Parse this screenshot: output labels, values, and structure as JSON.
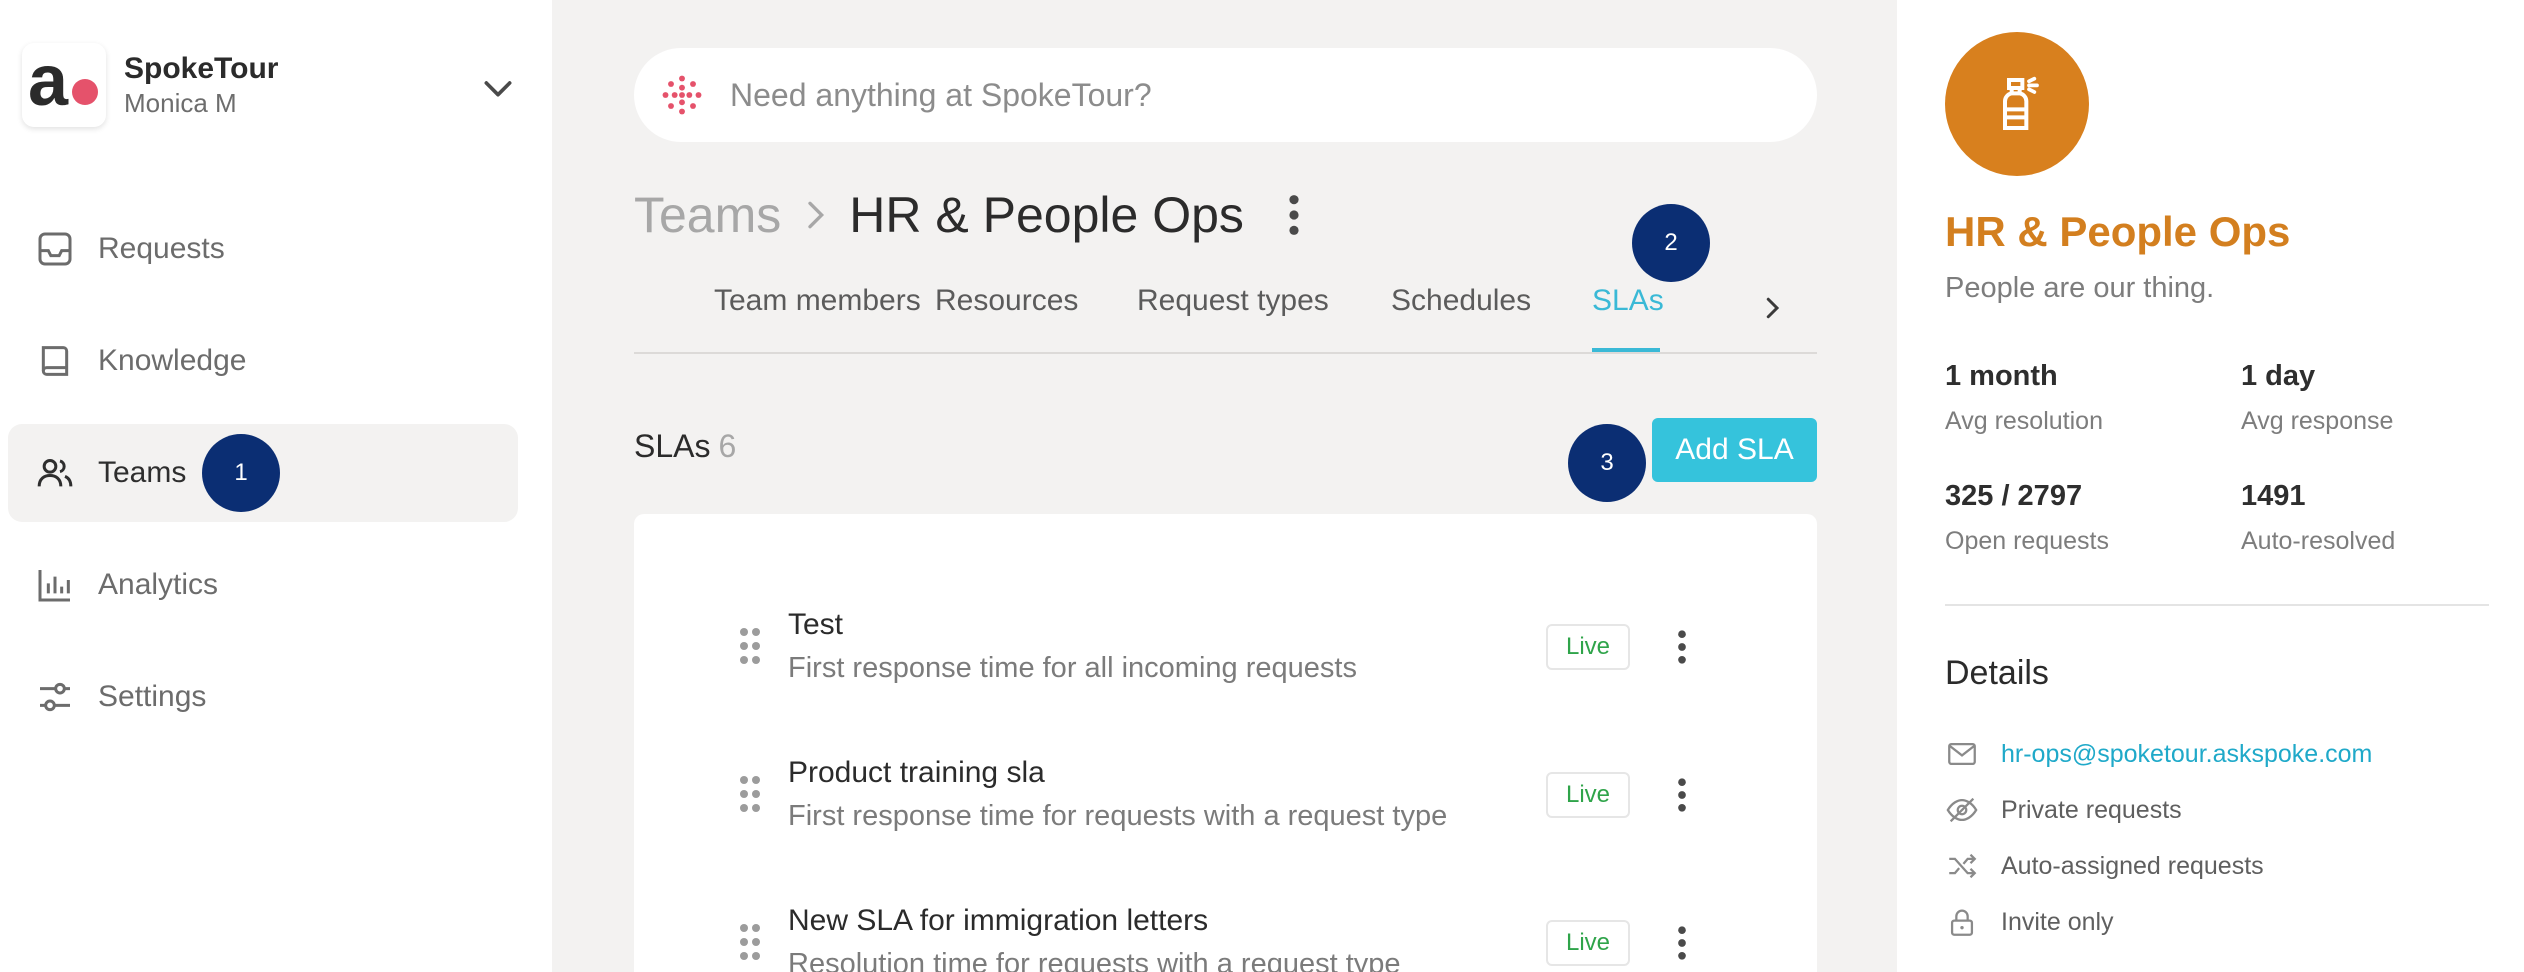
{
  "org": {
    "name": "SpokeTour",
    "user": "Monica M",
    "logo_letter": "a"
  },
  "sidebar": {
    "items": [
      {
        "label": "Requests",
        "icon": "inbox-icon"
      },
      {
        "label": "Knowledge",
        "icon": "book-icon"
      },
      {
        "label": "Teams",
        "icon": "people-icon",
        "active": true
      },
      {
        "label": "Analytics",
        "icon": "bar-chart-icon"
      },
      {
        "label": "Settings",
        "icon": "sliders-icon"
      }
    ]
  },
  "badges": {
    "b1": "1",
    "b2": "2",
    "b3": "3"
  },
  "search": {
    "placeholder": "Need anything at SpokeTour?"
  },
  "breadcrumb": {
    "root": "Teams",
    "current": "HR & People Ops"
  },
  "tabs": [
    {
      "label": "Team members"
    },
    {
      "label": "Resources"
    },
    {
      "label": "Request types"
    },
    {
      "label": "Schedules"
    },
    {
      "label": "SLAs",
      "active": true
    }
  ],
  "slas": {
    "title": "SLAs",
    "count": "6",
    "add_label": "Add SLA",
    "rows": [
      {
        "title": "Test",
        "subtitle": "First response time for all incoming requests",
        "status": "Live"
      },
      {
        "title": "Product training sla",
        "subtitle": "First response time for requests with a request type",
        "status": "Live"
      },
      {
        "title": "New SLA for immigration letters",
        "subtitle": "Resolution time for requests with a request type",
        "status": "Live"
      }
    ]
  },
  "team": {
    "name": "HR & People Ops",
    "description": "People are our thing.",
    "stats": [
      {
        "value": "1 month",
        "label": "Avg resolution"
      },
      {
        "value": "1 day",
        "label": "Avg response"
      },
      {
        "value": "325 / 2797",
        "label": "Open requests"
      },
      {
        "value": "1491",
        "label": "Auto-resolved"
      }
    ],
    "details_title": "Details",
    "details": [
      {
        "icon": "mail-icon",
        "text": "hr-ops@spoketour.askspoke.com"
      },
      {
        "icon": "eye-off-icon",
        "text": "Private requests"
      },
      {
        "icon": "shuffle-icon",
        "text": "Auto-assigned requests"
      },
      {
        "icon": "lock-icon",
        "text": "Invite only"
      }
    ]
  },
  "colors": {
    "accent": "#35c3dc",
    "team": "#d8801e",
    "badge": "#0b2e73",
    "live": "#2fa44a",
    "brand_dot": "#e5526b"
  }
}
